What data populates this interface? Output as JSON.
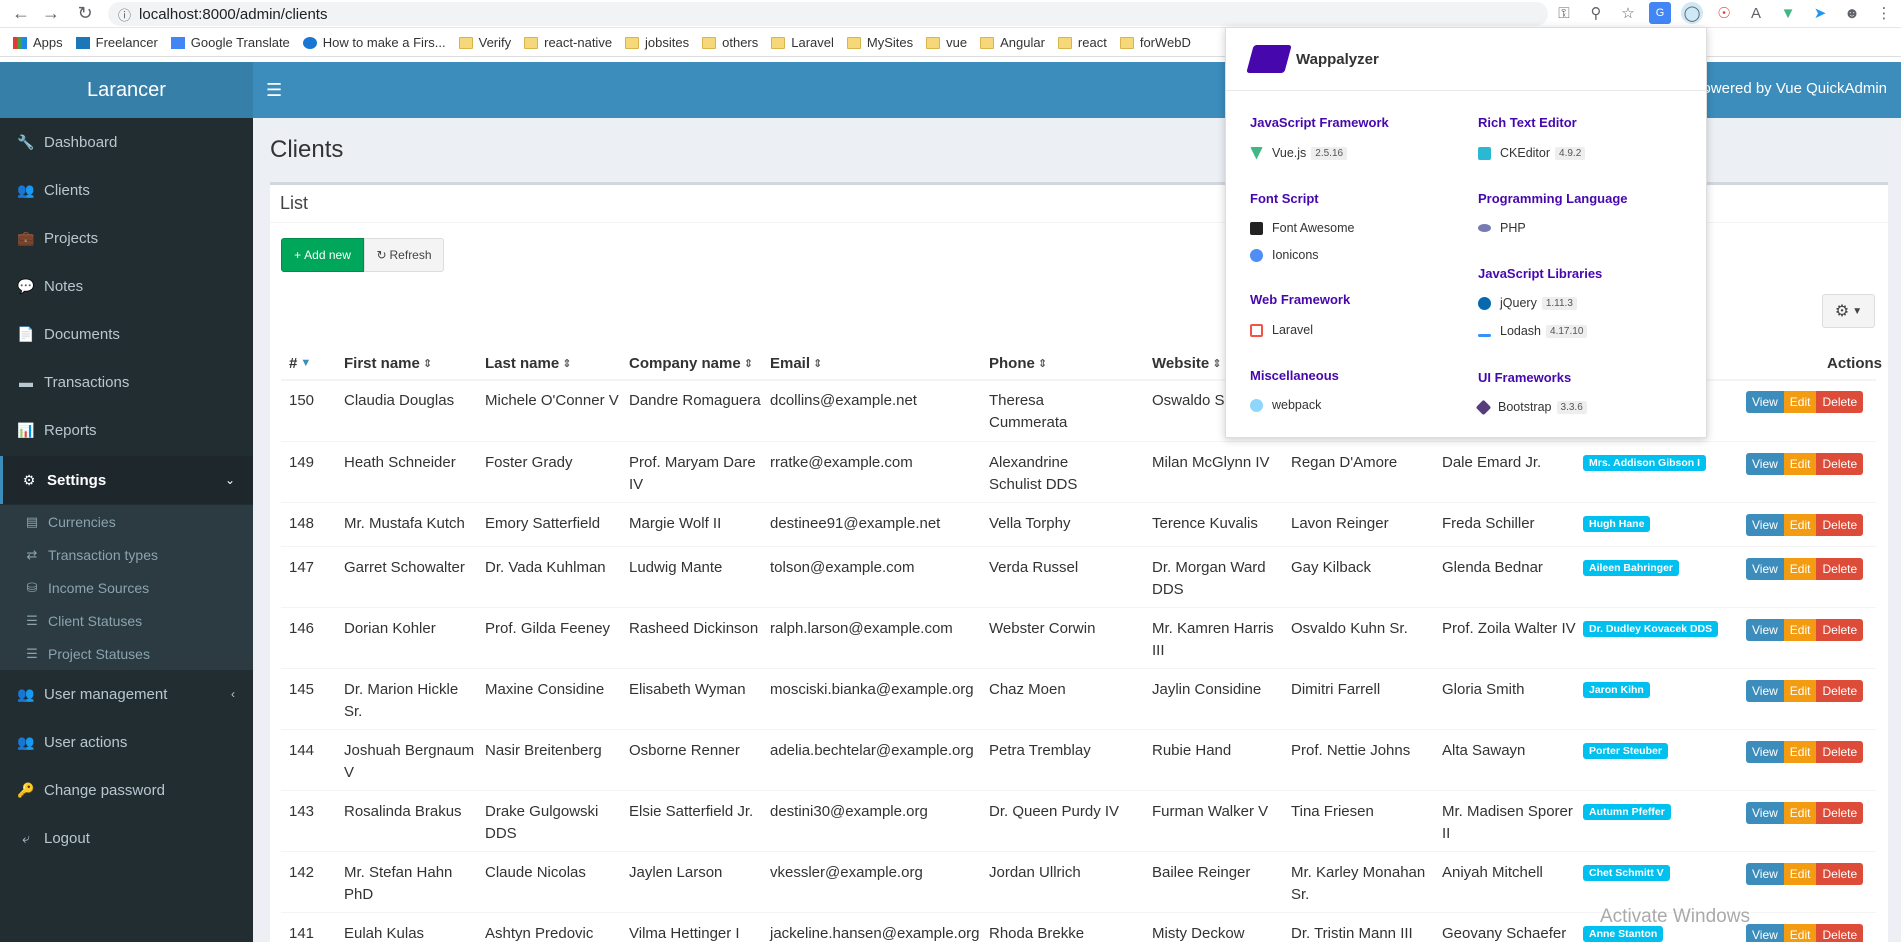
{
  "browser": {
    "url": "localhost:8000/admin/clients"
  },
  "bookmarks": [
    {
      "label": "Apps",
      "type": "apps"
    },
    {
      "label": "Freelancer",
      "type": "site"
    },
    {
      "label": "Google Translate",
      "type": "site"
    },
    {
      "label": "How to make a Firs...",
      "type": "site"
    },
    {
      "label": "Verify",
      "type": "folder"
    },
    {
      "label": "react-native",
      "type": "folder"
    },
    {
      "label": "jobsites",
      "type": "folder"
    },
    {
      "label": "others",
      "type": "folder"
    },
    {
      "label": "Laravel",
      "type": "folder"
    },
    {
      "label": "MySites",
      "type": "folder"
    },
    {
      "label": "vue",
      "type": "folder"
    },
    {
      "label": "Angular",
      "type": "folder"
    },
    {
      "label": "react",
      "type": "folder"
    },
    {
      "label": "forWebD",
      "type": "folder"
    }
  ],
  "app": {
    "logo": "Larancer",
    "powered": "Powered by Vue QuickAdmin"
  },
  "sidebar": {
    "items": [
      {
        "label": "Dashboard",
        "icon": "wrench-icon"
      },
      {
        "label": "Clients",
        "icon": "users-icon"
      },
      {
        "label": "Projects",
        "icon": "briefcase-icon"
      },
      {
        "label": "Notes",
        "icon": "comments-icon"
      },
      {
        "label": "Documents",
        "icon": "file-icon"
      },
      {
        "label": "Transactions",
        "icon": "credit-card-icon"
      },
      {
        "label": "Reports",
        "icon": "bar-chart-icon"
      },
      {
        "label": "Settings",
        "icon": "gears-icon"
      }
    ],
    "sub": [
      {
        "label": "Currencies",
        "icon": "money-icon"
      },
      {
        "label": "Transaction types",
        "icon": "exchange-icon"
      },
      {
        "label": "Income Sources",
        "icon": "database-icon"
      },
      {
        "label": "Client Statuses",
        "icon": "server-icon"
      },
      {
        "label": "Project Statuses",
        "icon": "server-icon"
      }
    ],
    "bottom": [
      {
        "label": "User management",
        "icon": "users-icon"
      },
      {
        "label": "User actions",
        "icon": "users-icon"
      },
      {
        "label": "Change password",
        "icon": "key-icon"
      },
      {
        "label": "Logout",
        "icon": "sign-out-icon"
      }
    ]
  },
  "page": {
    "title": "Clients",
    "box_title": "List",
    "add_new": "Add new",
    "refresh": "Refresh"
  },
  "table": {
    "headers": [
      "#",
      "First name",
      "Last name",
      "Company name",
      "Email",
      "Phone",
      "Website",
      "",
      "",
      "",
      "Actions"
    ],
    "actions": {
      "view": "View",
      "edit": "Edit",
      "delete": "Delete"
    },
    "rows": [
      {
        "id": "150",
        "first": "Claudia Douglas",
        "last": "Michele O'Conner V",
        "company": "Dandre Romaguera",
        "email": "dcollins@example.net",
        "phone": "Theresa Cummerata",
        "website": "Oswaldo Sc Jr.",
        "c8": "",
        "c9": "",
        "status": ""
      },
      {
        "id": "149",
        "first": "Heath Schneider",
        "last": "Foster Grady",
        "company": "Prof. Maryam Dare IV",
        "email": "rratke@example.com",
        "phone": "Alexandrine Schulist DDS",
        "website": "Milan McGlynn IV",
        "c8": "Regan D'Amore",
        "c9": "Dale Emard Jr.",
        "status": "Mrs. Addison Gibson I"
      },
      {
        "id": "148",
        "first": "Mr. Mustafa Kutch",
        "last": "Emory Satterfield",
        "company": "Margie Wolf II",
        "email": "destinee91@example.net",
        "phone": "Vella Torphy",
        "website": "Terence Kuvalis",
        "c8": "Lavon Reinger",
        "c9": "Freda Schiller",
        "status": "Hugh Hane"
      },
      {
        "id": "147",
        "first": "Garret Schowalter",
        "last": "Dr. Vada Kuhlman",
        "company": "Ludwig Mante",
        "email": "tolson@example.com",
        "phone": "Verda Russel",
        "website": "Dr. Morgan Ward DDS",
        "c8": "Gay Kilback",
        "c9": "Glenda Bednar",
        "status": "Aileen Bahringer"
      },
      {
        "id": "146",
        "first": "Dorian Kohler",
        "last": "Prof. Gilda Feeney",
        "company": "Rasheed Dickinson",
        "email": "ralph.larson@example.com",
        "phone": "Webster Corwin",
        "website": "Mr. Kamren Harris III",
        "c8": "Osvaldo Kuhn Sr.",
        "c9": "Prof. Zoila Walter IV",
        "status": "Dr. Dudley Kovacek DDS"
      },
      {
        "id": "145",
        "first": "Dr. Marion Hickle Sr.",
        "last": "Maxine Considine",
        "company": "Elisabeth Wyman",
        "email": "mosciski.bianka@example.org",
        "phone": "Chaz Moen",
        "website": "Jaylin Considine",
        "c8": "Dimitri Farrell",
        "c9": "Gloria Smith",
        "status": "Jaron Kihn"
      },
      {
        "id": "144",
        "first": "Joshuah Bergnaum V",
        "last": "Nasir Breitenberg",
        "company": "Osborne Renner",
        "email": "adelia.bechtelar@example.org",
        "phone": "Petra Tremblay",
        "website": "Rubie Hand",
        "c8": "Prof. Nettie Johns",
        "c9": "Alta Sawayn",
        "status": "Porter Steuber"
      },
      {
        "id": "143",
        "first": "Rosalinda Brakus",
        "last": "Drake Gulgowski DDS",
        "company": "Elsie Satterfield Jr.",
        "email": "destini30@example.org",
        "phone": "Dr. Queen Purdy IV",
        "website": "Furman Walker V",
        "c8": "Tina Friesen",
        "c9": "Mr. Madisen Sporer II",
        "status": "Autumn Pfeffer"
      },
      {
        "id": "142",
        "first": "Mr. Stefan Hahn PhD",
        "last": "Claude Nicolas",
        "company": "Jaylen Larson",
        "email": "vkessler@example.org",
        "phone": "Jordan Ullrich",
        "website": "Bailee Reinger",
        "c8": "Mr. Karley Monahan Sr.",
        "c9": "Aniyah Mitchell",
        "status": "Chet Schmitt V"
      },
      {
        "id": "141",
        "first": "Eulah Kulas",
        "last": "Ashtyn Predovic",
        "company": "Vilma Hettinger I",
        "email": "jackeline.hansen@example.org",
        "phone": "Rhoda Brekke",
        "website": "Misty Deckow",
        "c8": "Dr. Tristin Mann III",
        "c9": "Geovany Schaefer",
        "status": "Anne Stanton"
      }
    ]
  },
  "wappalyzer": {
    "name": "Wappalyzer",
    "categories": [
      {
        "name": "JavaScript Framework",
        "techs": [
          {
            "name": "Vue.js",
            "version": "2.5.16",
            "color": "#41b883"
          }
        ]
      },
      {
        "name": "Rich Text Editor",
        "techs": [
          {
            "name": "CKEditor",
            "version": "4.9.2",
            "color": "#2ab8d3"
          }
        ]
      },
      {
        "name": "Font Script",
        "techs": [
          {
            "name": "Font Awesome",
            "version": "",
            "color": "#222"
          },
          {
            "name": "Ionicons",
            "version": "",
            "color": "#4e8ef7"
          }
        ]
      },
      {
        "name": "Programming Language",
        "techs": [
          {
            "name": "PHP",
            "version": "",
            "color": "#777bb3"
          }
        ]
      },
      {
        "name": "JavaScript Libraries",
        "techs": [
          {
            "name": "jQuery",
            "version": "1.11.3",
            "color": "#0769ad"
          },
          {
            "name": "Lodash",
            "version": "4.17.10",
            "color": "#3492ff"
          }
        ]
      },
      {
        "name": "Web Framework",
        "techs": [
          {
            "name": "Laravel",
            "version": "",
            "color": "#f55247"
          }
        ]
      },
      {
        "name": "UI Frameworks",
        "techs": [
          {
            "name": "Bootstrap",
            "version": "3.3.6",
            "color": "#563d7c"
          }
        ]
      },
      {
        "name": "Miscellaneous",
        "techs": [
          {
            "name": "webpack",
            "version": "",
            "color": "#8ed6fb"
          }
        ]
      }
    ]
  },
  "watermark": {
    "text": "Activate Windows"
  },
  "colors": {
    "primary": "#3c8dbc",
    "sidebar": "#222d32",
    "success": "#00a65a",
    "warning": "#f39c12",
    "danger": "#dd4b39",
    "info": "#00c0ef",
    "wappalyzer": "#4608ad"
  }
}
